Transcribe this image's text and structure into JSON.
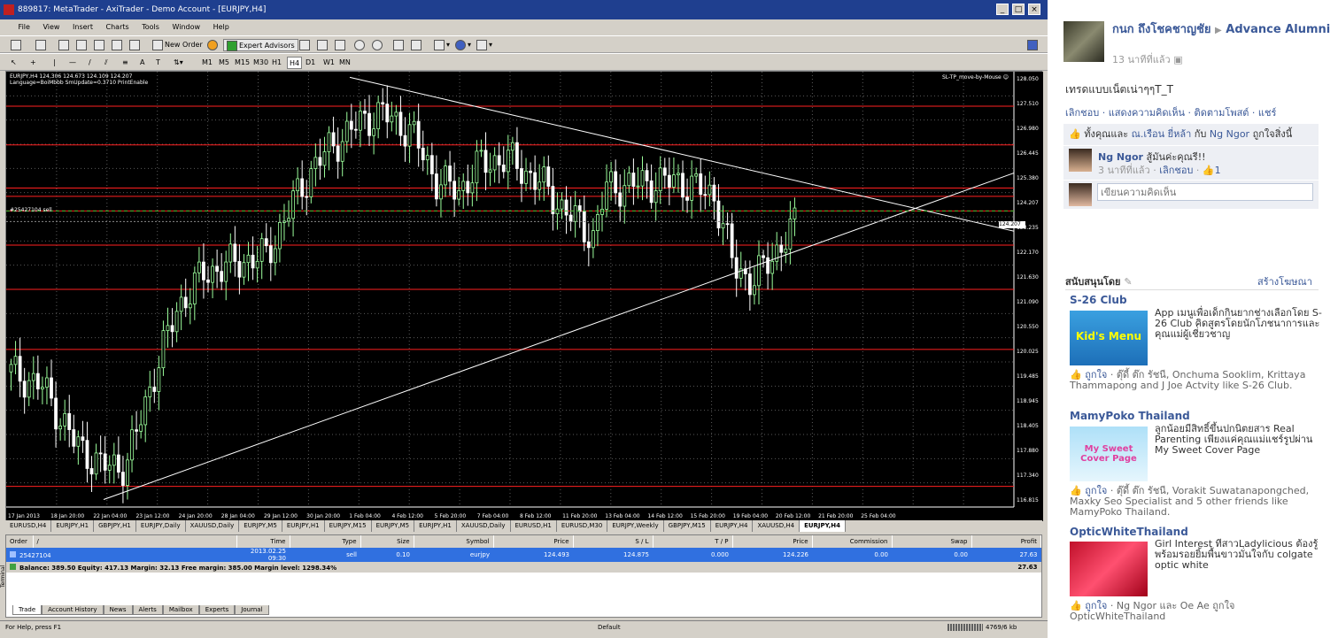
{
  "window": {
    "title": "889817: MetaTrader - AxiTrader - Demo Account - [EURJPY,H4]"
  },
  "menu": [
    "File",
    "View",
    "Insert",
    "Charts",
    "Tools",
    "Window",
    "Help"
  ],
  "toolbar": {
    "new_order": "New Order",
    "expert_advisors": "Expert Advisors",
    "timeframes": [
      "M1",
      "M5",
      "M15",
      "M30",
      "H1",
      "H4",
      "D1",
      "W1",
      "MN"
    ],
    "active_timeframe": "H4"
  },
  "chart": {
    "header_line1": "EURJPY,H4  124,306 124.673 124.109 124.207",
    "header_line2": "Language=BoiMbbb  SmUpdate=0.3710  PrintEnable",
    "ea_label": "SL-TP_move-by-Mouse",
    "order_label": "#25427104 sell",
    "current_price": "124.207",
    "price_ticks": [
      "128.050",
      "127.510",
      "126.980",
      "126.445",
      "125.380",
      "124.207",
      "123.235",
      "122.170",
      "121.630",
      "121.090",
      "120.550",
      "120.025",
      "119.485",
      "118.945",
      "118.405",
      "117.880",
      "117.340",
      "116.815"
    ],
    "time_ticks": [
      "17 Jan 2013",
      "18 Jan 20:00",
      "22 Jan 04:00",
      "23 Jan 12:00",
      "24 Jan 20:00",
      "28 Jan 04:00",
      "29 Jan 12:00",
      "30 Jan 20:00",
      "1 Feb 04:00",
      "4 Feb 12:00",
      "5 Feb 20:00",
      "7 Feb 04:00",
      "8 Feb 12:00",
      "11 Feb 20:00",
      "13 Feb 04:00",
      "14 Feb 12:00",
      "15 Feb 20:00",
      "19 Feb 04:00",
      "20 Feb 12:00",
      "21 Feb 20:00",
      "25 Feb 04:00"
    ],
    "colors": {
      "background": "#000000",
      "bull": "#9cff9c",
      "bear": "#ffffff",
      "hline": "#ff2020",
      "trendline": "#ffffff"
    }
  },
  "chart_tabs": [
    "EURUSD,H4",
    "EURJPY,H1",
    "GBPJPY,H1",
    "EURJPY,Daily",
    "XAUUSD,Daily",
    "EURJPY,M5",
    "EURJPY,H1",
    "EURJPY,M15",
    "EURJPY,M5",
    "EURJPY,H1",
    "XAUUSD,Daily",
    "EURUSD,H1",
    "EURUSD,M30",
    "EURJPY,Weekly",
    "GBPJPY,M15",
    "EURJPY,H4",
    "XAUUSD,H4",
    "EURJPY,H4"
  ],
  "active_chart_tab": "EURJPY,H4",
  "terminal": {
    "columns": [
      "Order",
      "/",
      "Time",
      "Type",
      "Size",
      "Symbol",
      "Price",
      "S / L",
      "T / P",
      "Price",
      "Commission",
      "Swap",
      "Profit"
    ],
    "rows": [
      {
        "order": "25427104",
        "time": "2013.02.25 09:30",
        "type": "sell",
        "size": "0.10",
        "symbol": "eurjpy",
        "price": "124.493",
        "sl": "124.875",
        "tp": "0.000",
        "cur_price": "124.226",
        "commission": "0.00",
        "swap": "0.00",
        "profit": "27.63"
      }
    ],
    "balance_line": "Balance: 389.50  Equity: 417.13  Margin: 32.13  Free margin: 385.00  Margin level: 1298.34%",
    "balance_profit": "27.63",
    "tabs": [
      "Trade",
      "Account History",
      "News",
      "Alerts",
      "Mailbox",
      "Experts",
      "Journal"
    ],
    "active_tab": "Trade",
    "side_label": "Terminal"
  },
  "status": {
    "help": "For Help, press F1",
    "profile": "Default",
    "traffic": "4769/6 kb"
  },
  "fb": {
    "author": "กนก ถึงโชคชาญชัย",
    "group": "Advance Alumni",
    "time": "13 นาทีที่แล้ว",
    "post": "เทรดแบบเน็ตเน่าๆๆT_T",
    "actions": [
      "เลิกชอบ",
      "แสดงความคิดเห็น",
      "ติดตามโพสต์",
      "แชร์"
    ],
    "likes_prefix": "ทั้งคุณและ",
    "likes_name1": "ณ.เรือน ยี่หล้า",
    "likes_mid": "กับ",
    "likes_name2": "Ng Ngor",
    "likes_suffix": "ถูกใจสิ่งนี้",
    "comment_author": "Ng Ngor",
    "comment_text": "สู้มันค่ะคุณรี!!",
    "comment_time": "3 นาทีที่แล้ว",
    "comment_unlike": "เลิกชอบ",
    "comment_likes": "1",
    "comment_placeholder": "เขียนความคิดเห็น",
    "sponsored": "สนับสนุนโดย",
    "create_ad": "สร้างโฆษณา",
    "ads": [
      {
        "title": "S-26 Club",
        "text": "App เมนูเพื่อเด็กกินยากช่างเลือกโดย S-26 Club คิดสูตรโดยนักโภชนาการและคุณแม่ผู้เชี่ยวชาญ",
        "like": "ถูกใจ",
        "social": "ตุ๊ดี้ ต๊ก รัชนี, Onchuma Sooklim, Krittaya Thammapong and J Joe Actvity like S-26 Club.",
        "img_text": "Kid's Menu"
      },
      {
        "title": "MamyPoko Thailand",
        "text": "ลูกน้อยมีสิทธิ์ขึ้นปกนิตยสาร Real Parenting เพียงแค่คุณแม่แชร์รูปผ่าน My Sweet Cover Page",
        "like": "ถูกใจ",
        "social": "ตุ๊ดี้ ต๊ก รัชนี, Vorakit Suwatanapongched, Maxky Seo Specialist and 5 other friends like MamyPoko Thailand.",
        "img_text": "My Sweet Cover Page"
      },
      {
        "title": "OpticWhiteThailand",
        "text": "Girl Interest ทีสาวLadylicious ต้องรู้ พร้อมรอยยิ้มพื้นขาวมั่นใจกับ colgate optic white",
        "like": "ถูกใจ",
        "social": "Ng Ngor และ Oe Ae ถูกใจ OpticWhiteThailand",
        "img_text": ""
      }
    ]
  }
}
